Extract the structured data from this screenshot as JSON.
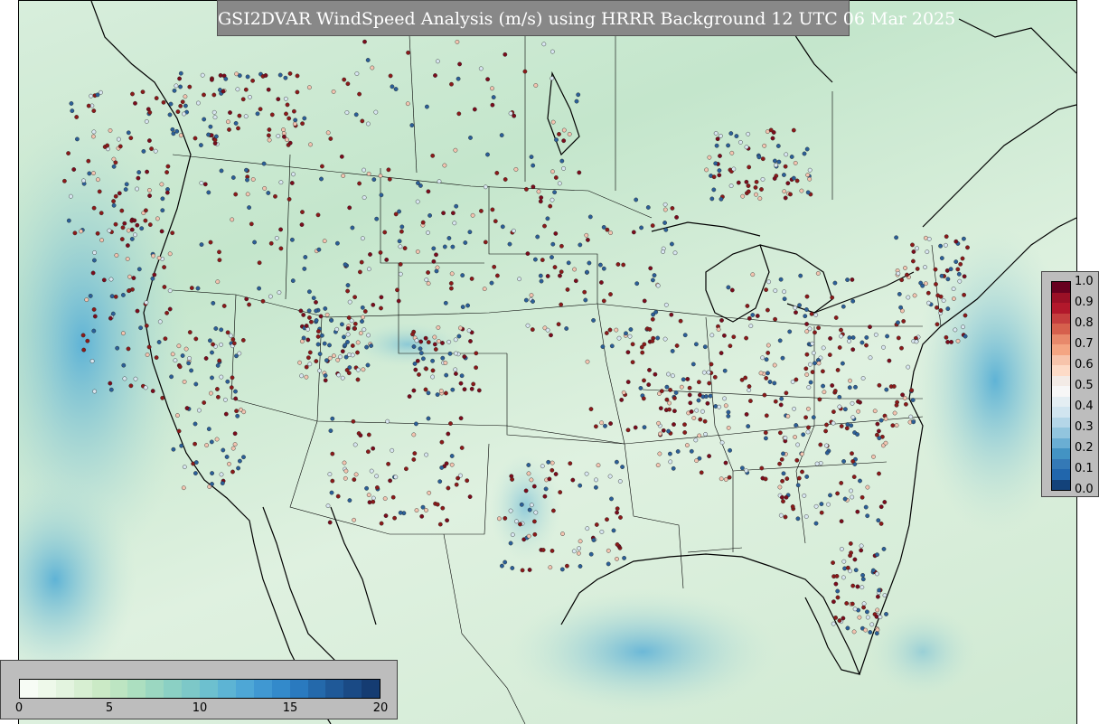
{
  "title": "GSI2DVAR WindSpeed Analysis (m/s) using HRRR Background 12 UTC 06 Mar 2025",
  "obs_legend": {
    "ticks": [
      "1.0",
      "0.9",
      "0.8",
      "0.7",
      "0.6",
      "0.5",
      "0.4",
      "0.3",
      "0.2",
      "0.1",
      "0.0"
    ],
    "colors": [
      "#67001f",
      "#9a1026",
      "#b2182b",
      "#c53e3e",
      "#d6604d",
      "#e8896b",
      "#f4a582",
      "#f7c4ab",
      "#fddbc7",
      "#f3ebe6",
      "#f7f7f7",
      "#e4eef3",
      "#d1e5f0",
      "#b4d6e8",
      "#92c5de",
      "#6aaed3",
      "#4393c3",
      "#3479b6",
      "#2166ac",
      "#13427a"
    ]
  },
  "speed_legend": {
    "ticks": [
      "0",
      "5",
      "10",
      "15",
      "20"
    ],
    "colors": [
      "#f7fcf5",
      "#eef9ea",
      "#e3f4df",
      "#d7efd2",
      "#cbeac6",
      "#bde5c2",
      "#acdfc0",
      "#9bd7c1",
      "#8bd0c4",
      "#7dc8c8",
      "#6dc0cf",
      "#5db4d4",
      "#4ea7d6",
      "#4098d2",
      "#338acb",
      "#2a7abf",
      "#2469ab",
      "#1f5998",
      "#1a4a85",
      "#153c72"
    ]
  },
  "map": {
    "background_color": "#cde8d1",
    "obs_colors": {
      "high": "#8b1a1a",
      "mid": "#f2c4b0",
      "low": "#2b5f98"
    }
  }
}
